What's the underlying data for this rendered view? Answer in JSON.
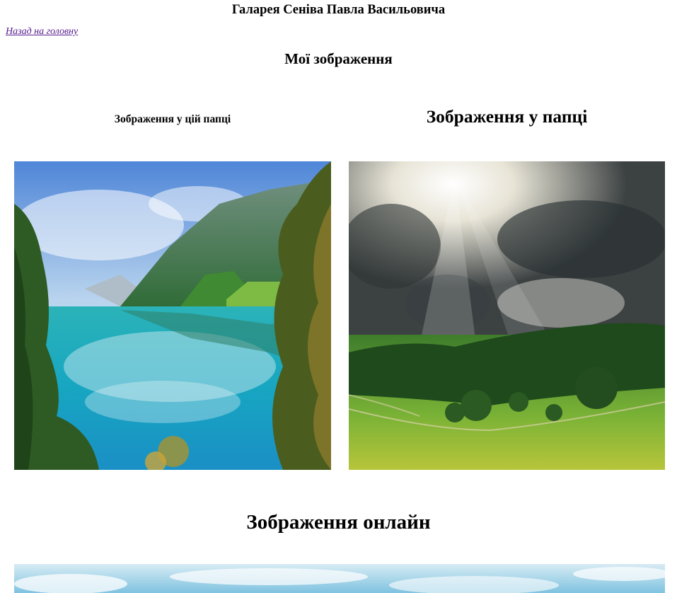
{
  "site_title": "Галарея Сеніва Павла Васильовича",
  "back_link": "Назад на головну",
  "section_title": "Мої зображення",
  "left_column": {
    "title": "Зображення у цій папці"
  },
  "right_column": {
    "title": "Зображення у папці"
  },
  "online_section": {
    "title": "Зображення онлайн"
  },
  "images": [
    {
      "subject": "mountain lake with turquoise water, green mountains and foliage"
    },
    {
      "subject": "sun rays through storm clouds over green forest meadow"
    },
    {
      "subject": "sky with clouds (partially visible)"
    }
  ]
}
